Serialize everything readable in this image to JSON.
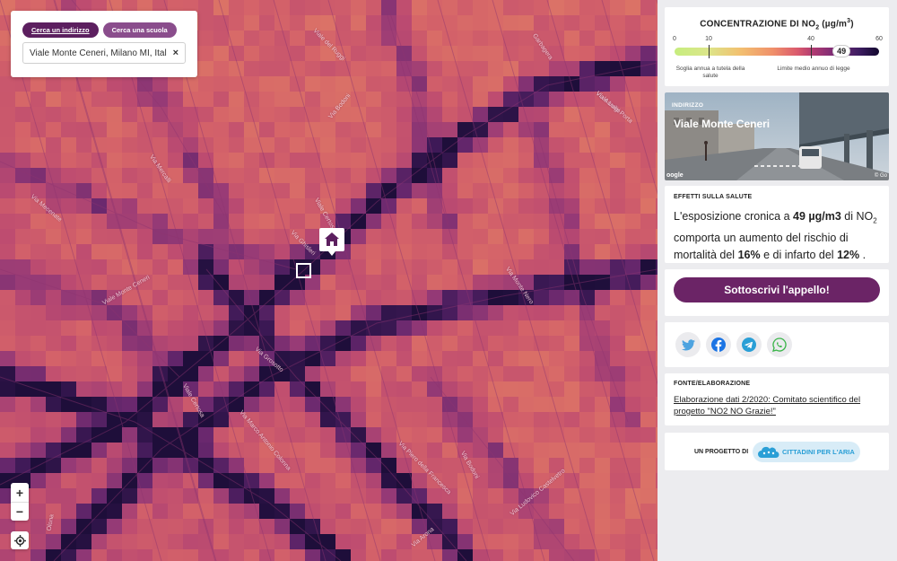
{
  "search": {
    "tab_address": "Cerca un indirizzo",
    "tab_school": "Cerca una scuola",
    "input_value": "Viale Monte Ceneri, Milano MI, Ital",
    "clear": "×"
  },
  "map": {
    "zoom_in": "+",
    "zoom_out": "−",
    "street_labels": [
      "Viale del Ruggi",
      "Via Bodoni",
      "Via Mercalli",
      "Via Mecenate",
      "Viale Certosa",
      "Via Ghisleri",
      "Viale Monte Ceneri",
      "Via Grosotto",
      "Viale Certosa",
      "Via Marco Antonio Colonna",
      "Via Monte Nero",
      "Via Piero della Francesca",
      "Via Bodoni",
      "Via Ludovico Castelvetro",
      "Via Aurelio",
      "Olona",
      "Garbagera",
      "Viale Luigi Porta",
      "Via Arona"
    ],
    "colors": {
      "low": "#c6ed7e",
      "high": "#12082e"
    }
  },
  "legend": {
    "title_pre": "CONCENTRAZIONE DI NO",
    "title_sub": "2",
    "title_unit_pre": " (µg/m",
    "title_unit_sup": "3",
    "title_unit_post": ")",
    "ticks": [
      "0",
      "10",
      "40",
      "60"
    ],
    "value": "49",
    "value_num": 49,
    "range_max": 60,
    "who_label": "Soglia annua a tutela della salute",
    "legal_label": "Limite medio annuo di legge"
  },
  "address": {
    "label": "INDIRIZZO",
    "name": "Viale Monte Ceneri",
    "google": "oogle",
    "google_right": "© Go"
  },
  "health": {
    "label": "EFFETTI SULLA SALUTE",
    "t1": "L'esposizione cronica a ",
    "value": "49 µg/m3",
    "t2": " di NO",
    "sub": "2",
    "t3": " comporta un aumento del rischio di mortalità del ",
    "mortality": "16%",
    "t4": " e di infarto del ",
    "infarct": "12%",
    "t5": " ."
  },
  "cta": {
    "label": "Sottoscrivi l'appello!"
  },
  "share": {
    "icons": [
      "twitter-icon",
      "facebook-icon",
      "telegram-icon",
      "whatsapp-icon"
    ]
  },
  "source": {
    "label": "FONTE/ELABORAZIONE",
    "text": "Elaborazione dati 2/2020: Comitato scientifico del progetto \"NO2 NO Grazie!\""
  },
  "project": {
    "label": "UN PROGETTO DI",
    "partner": "CITTADINI PER L'ARIA"
  }
}
